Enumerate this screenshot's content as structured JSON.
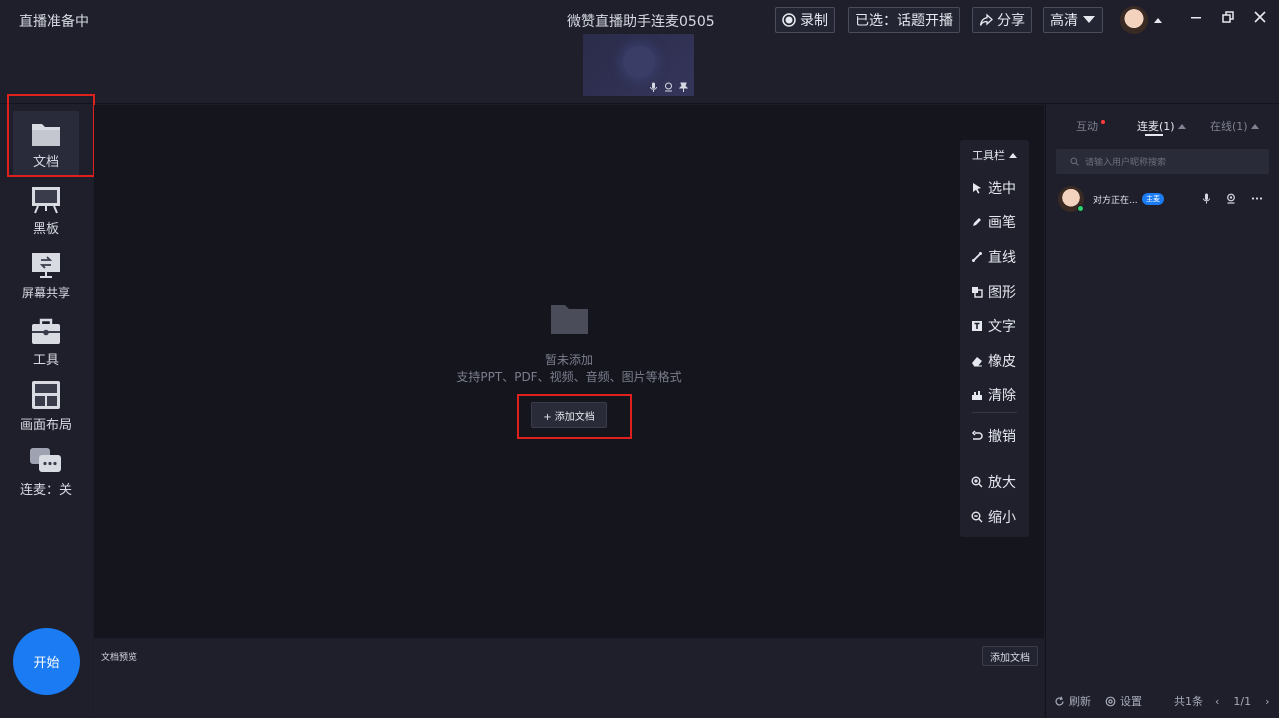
{
  "topbar": {
    "status": "直播准备中",
    "title": "微赞直播助手连麦0505",
    "record_label": "录制",
    "selected_label": "已选：话题开播",
    "share_label": "分享",
    "quality_label": "高清"
  },
  "sidebar": {
    "items": [
      {
        "label": "文档"
      },
      {
        "label": "黑板"
      },
      {
        "label": "屏幕共享"
      },
      {
        "label": "工具"
      },
      {
        "label": "画面布局"
      },
      {
        "label": "连麦：关"
      }
    ],
    "start_label": "开始"
  },
  "stage": {
    "empty_title": "暂未添加",
    "empty_sub": "支持PPT、PDF、视频、音频、图片等格式",
    "add_doc_label": "+ 添加文档"
  },
  "toolbox": {
    "title": "工具栏",
    "tools": [
      "选中",
      "画笔",
      "直线",
      "图形",
      "文字",
      "橡皮",
      "清除",
      "撤销",
      "放大",
      "缩小"
    ]
  },
  "docbar": {
    "label": "文档预览",
    "add_label": "添加文档"
  },
  "right": {
    "tabs": [
      "互动",
      "连麦(1)",
      "在线(1)"
    ],
    "search_placeholder": "请输入用户昵称搜索",
    "user_name": "对方正在...",
    "host_badge": "主麦",
    "refresh_label": "刷新",
    "settings_label": "设置",
    "total_label": "共1条",
    "page_label": "1/1"
  },
  "colors": {
    "accent": "#1a7bf2",
    "highlight": "#e0201d",
    "background": "#1b1c27"
  }
}
